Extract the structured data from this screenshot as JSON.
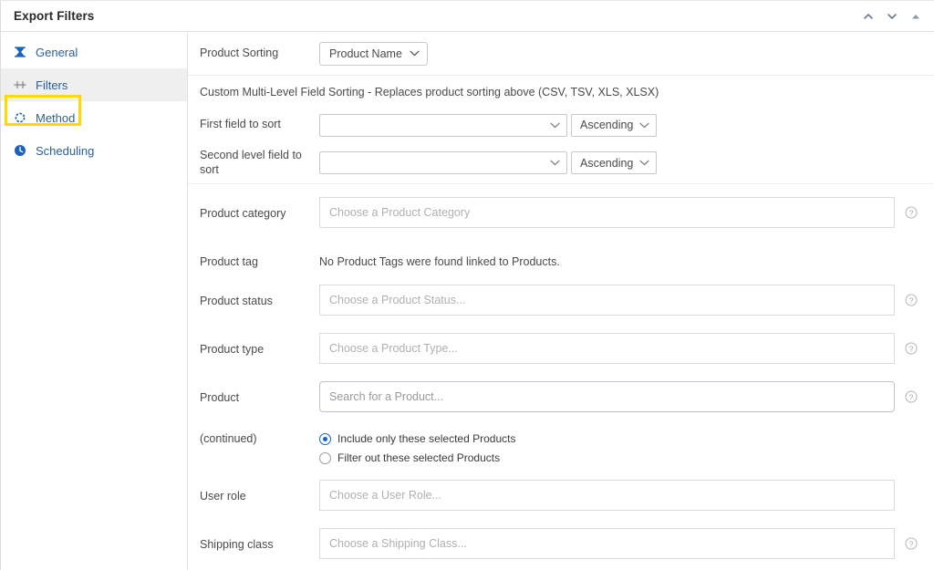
{
  "window": {
    "title": "Export Filters",
    "controls": [
      {
        "name": "collapse-up-chevron",
        "label": "Move up"
      },
      {
        "name": "expand-down-chevron",
        "label": "Move down"
      },
      {
        "name": "collapse-panel-triangle",
        "label": "Collapse"
      }
    ]
  },
  "sidebar": {
    "items": [
      {
        "label": "General",
        "icon": "bowtie-icon",
        "active": false
      },
      {
        "label": "Filters",
        "icon": "filters-icon",
        "active": true
      },
      {
        "label": "Method",
        "icon": "gear-icon",
        "active": false
      },
      {
        "label": "Scheduling",
        "icon": "clock-icon",
        "active": false
      }
    ],
    "highlight": {
      "target": "Filters",
      "color": "#ffd900"
    }
  },
  "main": {
    "product_sorting": {
      "label": "Product Sorting",
      "value": "Product Name"
    },
    "custom_sorting_note": "Custom Multi-Level Field Sorting - Replaces product sorting above (CSV, TSV, XLS, XLSX)",
    "sort_rows": [
      {
        "label": "First field to sort",
        "field_value": "",
        "direction": "Ascending"
      },
      {
        "label": "Second level field to sort",
        "field_value": "",
        "direction": "Ascending"
      }
    ],
    "filters": [
      {
        "label": "Product category",
        "type": "input",
        "placeholder": "Choose a Product Category",
        "help": true,
        "focused": false
      },
      {
        "label": "Product tag",
        "type": "text",
        "text": "No Product Tags were found linked to Products.",
        "help": false
      },
      {
        "label": "Product status",
        "type": "input",
        "placeholder": "Choose a Product Status...",
        "help": true,
        "focused": false
      },
      {
        "label": "Product type",
        "type": "input",
        "placeholder": "Choose a Product Type...",
        "help": true,
        "focused": false
      },
      {
        "label": "Product",
        "type": "input",
        "placeholder": "Search for a Product...",
        "help": true,
        "focused": true
      },
      {
        "label": "(continued)",
        "type": "radio",
        "help": false,
        "options": [
          {
            "label": "Include only these selected Products",
            "selected": true
          },
          {
            "label": "Filter out these selected Products",
            "selected": false
          }
        ]
      },
      {
        "label": "User role",
        "type": "input",
        "placeholder": "Choose a User Role...",
        "help": false,
        "focused": false
      },
      {
        "label": "Shipping class",
        "type": "input",
        "placeholder": "Choose a Shipping Class...",
        "help": true,
        "focused": false
      }
    ]
  },
  "colors": {
    "link": "#2b5f9e",
    "accent": "#1c62b9",
    "highlight": "#ffd900",
    "border": "#dcdcdc"
  }
}
